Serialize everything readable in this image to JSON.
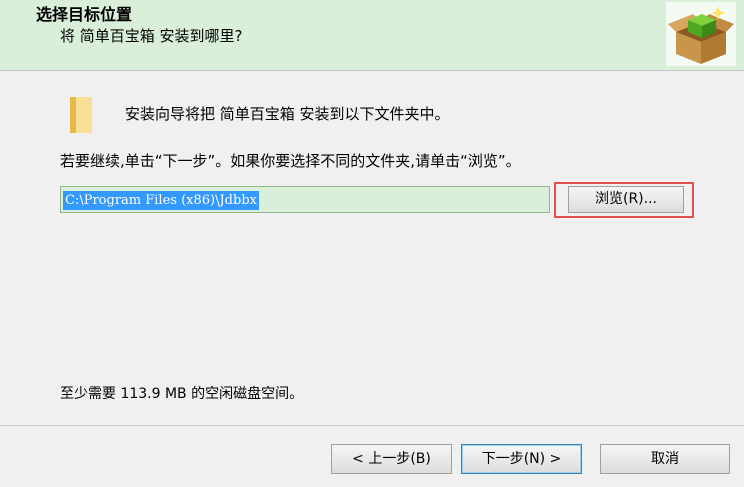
{
  "header": {
    "title": "选择目标位置",
    "subtitle": "将 简单百宝箱 安装到哪里?",
    "icon": "installer-box-icon"
  },
  "body": {
    "folder_icon": "folder-icon",
    "intro_text": "安装向导将把 简单百宝箱 安装到以下文件夹中。",
    "instruction_text": "若要继续,单击“下一步”。如果你要选择不同的文件夹,请单击“浏览”。",
    "install_path": "C:\\Program Files (x86)\\Jdbbx",
    "browse_label": "浏览(R)...",
    "disk_space_text": "至少需要 113.9 MB 的空闲磁盘空间。"
  },
  "footer": {
    "back_label": "< 上一步(B)",
    "next_label": "下一步(N) >",
    "cancel_label": "取消"
  },
  "colors": {
    "header_bg": "#d9efd9",
    "input_bg": "#d9efd9",
    "selection": "#3399ff",
    "highlight_border": "#e05050"
  }
}
